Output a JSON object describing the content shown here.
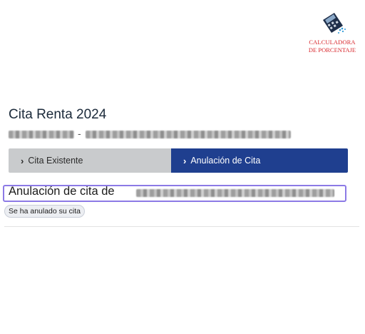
{
  "logo": {
    "line1": "CALCULADORA",
    "line2": "DE PORCENTAJE",
    "icon": "calculator-icon",
    "color": "#d8262b"
  },
  "page": {
    "title": "Cita Renta 2024",
    "subtitle_separator": "-"
  },
  "tabs": [
    {
      "label": "Cita Existente",
      "icon": "chevron-right-icon",
      "active": false
    },
    {
      "label": "Anulación de Cita",
      "icon": "chevron-right-icon",
      "active": true
    }
  ],
  "section": {
    "title": "Anulación de cita de",
    "status": "Se ha anulado su cita"
  },
  "colors": {
    "active_tab": "#1f3f8f",
    "inactive_tab": "#c9cbcd",
    "focus_outline": "#8c7ae6"
  }
}
